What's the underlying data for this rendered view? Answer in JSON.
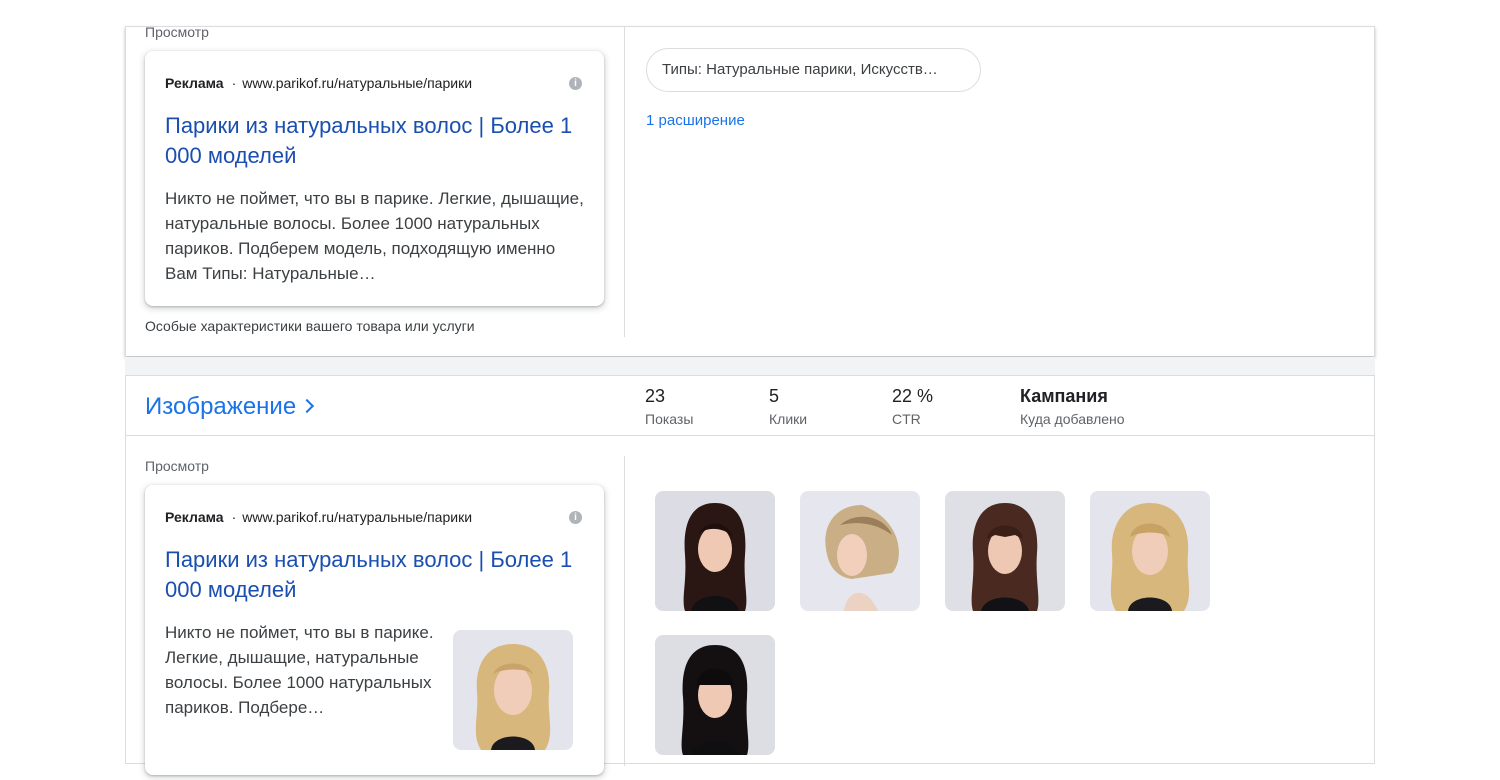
{
  "top_panel": {
    "preview_label": "Просмотр",
    "ad": {
      "sponsored_label": "Реклама",
      "separator": "·",
      "display_url": "www.parikof.ru/натуральные/парики",
      "headline": "Парики из натуральных волос | Более 1 000 моделей",
      "description": "Никто не поймет, что вы в парике. Легкие, дышащие, натуральные волосы. Более 1000 натуральных париков. Подберем модель, подходящую именно Вам Типы: Натуральные…"
    },
    "footnote": "Особые характеристики вашего товара или услуги",
    "snippet_chip": "Типы: Натуральные парики, Искусств…",
    "extension_link": "1 расширение"
  },
  "image_section": {
    "title": "Изображение",
    "stats": [
      {
        "value": "23",
        "label": "Показы"
      },
      {
        "value": "5",
        "label": "Клики"
      },
      {
        "value": "22 %",
        "label": "CTR"
      },
      {
        "value": "Кампания",
        "label": "Куда добавлено"
      }
    ],
    "preview_label": "Просмотр",
    "ad": {
      "sponsored_label": "Реклама",
      "separator": "·",
      "display_url": "www.parikof.ru/натуральные/парики",
      "headline": "Парики из натуральных волос | Более 1 000 моделей",
      "description": "Никто не поймет, что вы в парике. Легкие, дышащие, натуральные волосы. Более 1000 натуральных париков. Подбере…"
    },
    "thumbnails": [
      {
        "icon": "wig-photo-dark-long",
        "hair_color": "#2a1612"
      },
      {
        "icon": "wig-photo-blonde-bob",
        "hair_color": "#c9ae86"
      },
      {
        "icon": "wig-photo-brown-bangs",
        "hair_color": "#4a2a20"
      },
      {
        "icon": "wig-photo-blonde-wavy",
        "hair_color": "#d8b77c"
      },
      {
        "icon": "wig-photo-black-bangs",
        "hair_color": "#141012"
      }
    ]
  },
  "colors": {
    "link_blue": "#1a73e8",
    "headline_blue": "#1a4fb0",
    "border": "#dadce0"
  }
}
